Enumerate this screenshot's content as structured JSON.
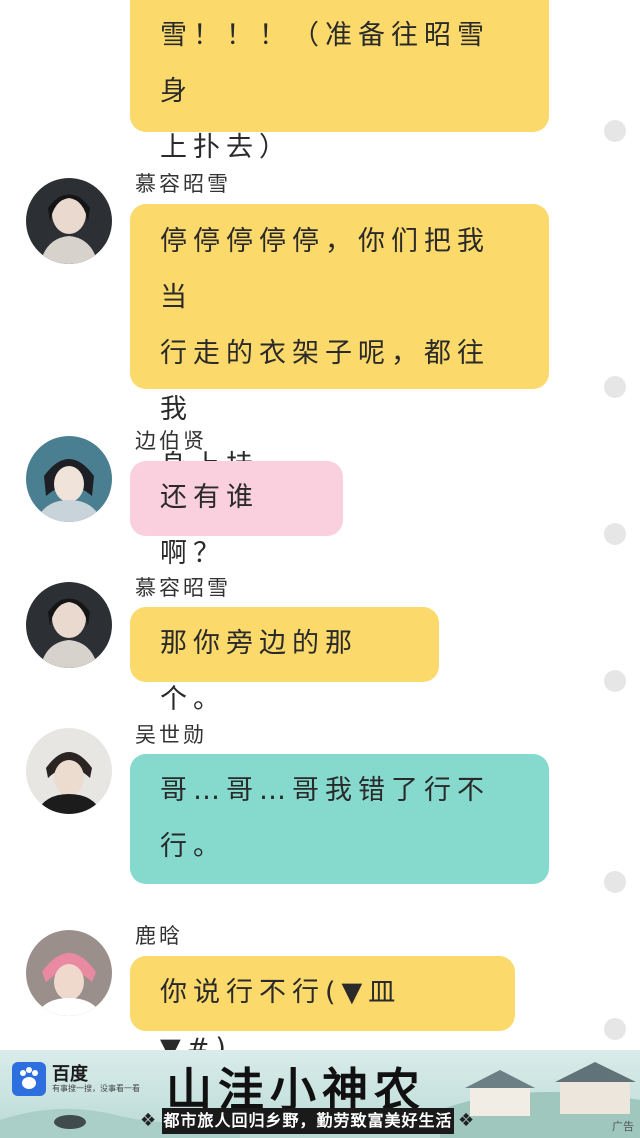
{
  "messages": [
    {
      "lines": [
        "雪！！！（准备往昭雪身",
        "上扑去）"
      ]
    },
    {
      "name": "慕容昭雪",
      "lines": [
        "停停停停停，你们把我当",
        "行走的衣架子呢，都往我",
        "身上挂。"
      ]
    },
    {
      "name": "边伯贤",
      "lines": [
        "还有谁啊？"
      ]
    },
    {
      "name": "慕容昭雪",
      "lines": [
        "那你旁边的那个。"
      ]
    },
    {
      "name": "吴世勋",
      "lines": [
        "哥…哥…哥我错了行不",
        "行。"
      ]
    },
    {
      "name": "鹿晗",
      "lines": [
        "你说行不行(▼皿▼#)。"
      ]
    }
  ],
  "ad": {
    "brand": "百度",
    "slogan": "有事搜一搜，没事看一看",
    "title": "山洼小神农",
    "tagline": "都市旅人回归乡野，勤劳致富美好生活",
    "corner": "广告"
  },
  "icons": {
    "ad_logo": "baidu-paw-icon",
    "ornament": "scroll-ornament-icon"
  },
  "colors": {
    "yellow_bubble": "#fbd96b",
    "pink_bubble": "#fbd0de",
    "teal_bubble": "#85d9cd",
    "baidu_blue": "#2e6fe0"
  }
}
